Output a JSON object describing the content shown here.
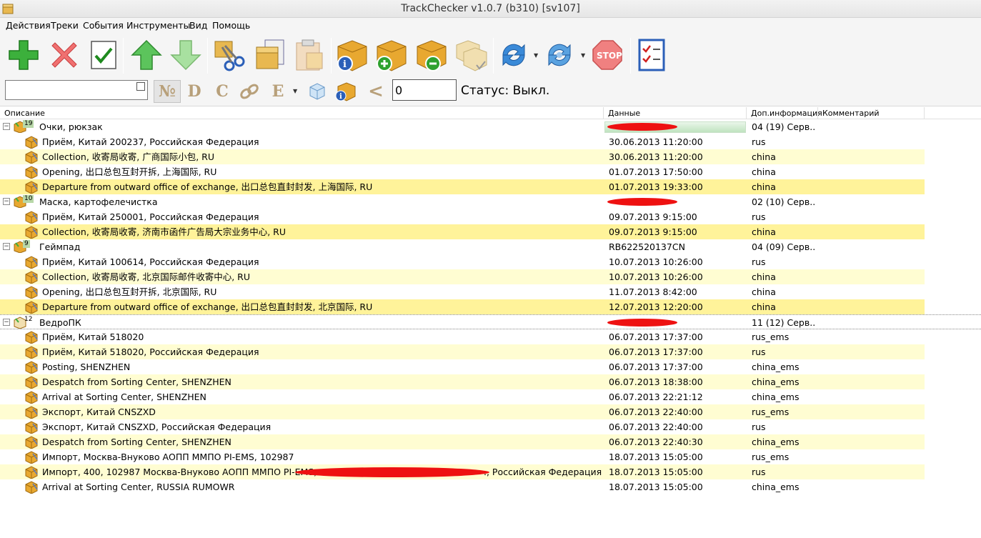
{
  "window": {
    "title": "TrackChecker v1.0.7 (b310)  [sv107]"
  },
  "menu": [
    "Действия",
    "Треки",
    "События",
    "Инструменты",
    "Вид",
    "Помощь"
  ],
  "toolbar": {
    "buttons": [
      "add-icon",
      "delete-icon",
      "check-icon",
      "move-up-icon",
      "move-down-icon",
      "cut-icon",
      "copy-icon",
      "paste-icon",
      "package-info-icon",
      "package-add-icon",
      "package-remove-icon",
      "package-multi-icon",
      "refresh-icon",
      "refresh-all-icon",
      "stop-icon",
      "checklist-icon"
    ]
  },
  "filterbar": {
    "search_value": "",
    "sort_buttons": [
      "№",
      "D",
      "C",
      "⚗",
      "E"
    ],
    "compare_sign": "<",
    "number_value": "0",
    "status_text": "Статус: Выкл."
  },
  "columns": [
    "Описание",
    "Данные",
    "Доп.информация",
    "Комментарий"
  ],
  "groups": [
    {
      "count": "19",
      "name": "Очки, рюкзак",
      "data": "",
      "info": "04 (19) Серв...",
      "progress": 0.99
    },
    {
      "count": "10",
      "name": "Маска, картофелечистка",
      "data": "",
      "info": "02 (10) Серв..."
    },
    {
      "count": "9",
      "name": "Геймпад",
      "data": "RB622520137CN",
      "info": "04 (09) Серв..."
    },
    {
      "count": "12",
      "name": "ВедроПК",
      "data": "",
      "info": "11 (12) Серв..."
    }
  ],
  "events": [
    {
      "g": 0,
      "desc": "Приём, Китай 200237, Российская Федерация",
      "date": "30.06.2013 11:20:00",
      "info": "rus"
    },
    {
      "g": 0,
      "desc": "Collection, 收寄局收寄, 广商国际小包, RU",
      "date": "30.06.2013 11:20:00",
      "info": "china"
    },
    {
      "g": 0,
      "desc": "Opening, 出口总包互封开拆, 上海国际, RU",
      "date": "01.07.2013 17:50:00",
      "info": "china"
    },
    {
      "g": 0,
      "desc": "Departure from outward office of exchange, 出口总包直封封发, 上海国际, RU",
      "date": "01.07.2013 19:33:00",
      "info": "china"
    },
    {
      "g": 1,
      "desc": "Приём, Китай 250001, Российская Федерация",
      "date": "09.07.2013 9:15:00",
      "info": "rus"
    },
    {
      "g": 1,
      "desc": "Collection, 收寄局收寄, 济南市函件广告局大宗业务中心, RU",
      "date": "09.07.2013 9:15:00",
      "info": "china"
    },
    {
      "g": 2,
      "desc": "Приём, Китай 100614, Российская Федерация",
      "date": "10.07.2013 10:26:00",
      "info": "rus"
    },
    {
      "g": 2,
      "desc": "Collection, 收寄局收寄, 北京国际邮件收寄中心, RU",
      "date": "10.07.2013 10:26:00",
      "info": "china"
    },
    {
      "g": 2,
      "desc": "Opening, 出口总包互封开拆, 北京国际, RU",
      "date": "11.07.2013 8:42:00",
      "info": "china"
    },
    {
      "g": 2,
      "desc": "Departure from outward office of exchange, 出口总包直封封发, 北京国际, RU",
      "date": "12.07.2013 12:20:00",
      "info": "china"
    },
    {
      "g": 3,
      "desc": "Приём, Китай 518020",
      "date": "06.07.2013 17:37:00",
      "info": "rus_ems"
    },
    {
      "g": 3,
      "desc": "Приём, Китай 518020, Российская Федерация",
      "date": "06.07.2013 17:37:00",
      "info": "rus"
    },
    {
      "g": 3,
      "desc": "Posting, SHENZHEN",
      "date": "06.07.2013 17:37:00",
      "info": "china_ems"
    },
    {
      "g": 3,
      "desc": "Despatch from Sorting Center, SHENZHEN",
      "date": "06.07.2013 18:38:00",
      "info": "china_ems"
    },
    {
      "g": 3,
      "desc": "Arrival at Sorting Center, SHENZHEN",
      "date": "06.07.2013 22:21:12",
      "info": "china_ems"
    },
    {
      "g": 3,
      "desc": "Экспорт, Китай CNSZXD",
      "date": "06.07.2013 22:40:00",
      "info": "rus_ems"
    },
    {
      "g": 3,
      "desc": "Экспорт, Китай CNSZXD, Российская Федерация",
      "date": "06.07.2013 22:40:00",
      "info": "rus"
    },
    {
      "g": 3,
      "desc": "Despatch from Sorting Center, SHENZHEN",
      "date": "06.07.2013 22:40:30",
      "info": "china_ems"
    },
    {
      "g": 3,
      "desc": "Импорт, Москва-Внуково АОПП ММПО PI-EMS, 102987",
      "date": "18.07.2013 15:05:00",
      "info": "rus_ems"
    },
    {
      "g": 3,
      "desc": "Импорт, 400, 102987 Москва-Внуково АОПП ММПО PI-EMS, ",
      "desc_tail": "., Российская Федерация",
      "date": "18.07.2013 15:05:00",
      "info": "rus"
    },
    {
      "g": 3,
      "desc": "Arrival at Sorting Center, RUSSIA RUMOWR",
      "date": "18.07.2013 15:05:00",
      "info": "china_ems"
    }
  ]
}
